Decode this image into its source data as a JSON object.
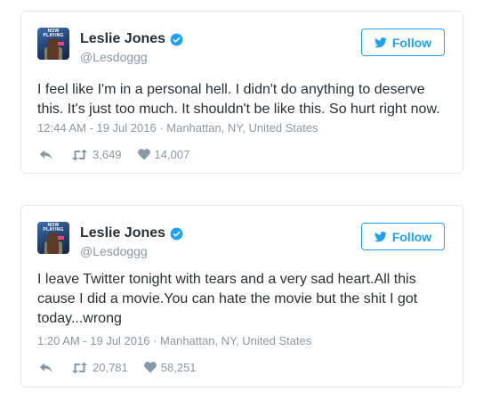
{
  "colors": {
    "brand": "#1da1f2",
    "text": "#292f33",
    "muted": "#8899a6",
    "border": "#e1e8ed"
  },
  "tweets": [
    {
      "name": "Leslie Jones",
      "handle": "@Lesdoggg",
      "avatar_tag": "NOW PLAYING",
      "follow_label": "Follow",
      "text": "I feel like I'm in a personal hell. I didn't do anything to deserve\nthis. It's just too much. It shouldn't be like this. So hurt right now.",
      "meta": "12:44 AM - 19 Jul 2016 · Manhattan, NY, United States",
      "retweets": "3,649",
      "likes": "14,007",
      "icons": [
        "verified-icon",
        "twitter-bird-icon",
        "reply-icon",
        "retweet-icon",
        "heart-icon"
      ]
    },
    {
      "name": "Leslie Jones",
      "handle": "@Lesdoggg",
      "avatar_tag": "NOW PLAYING",
      "follow_label": "Follow",
      "text": "I leave Twitter tonight with tears and a very sad heart.All this\ncause I did a movie.You can hate the movie but the shit I got\ntoday...wrong",
      "meta": "1:20 AM - 19 Jul 2016 · Manhattan, NY, United States",
      "retweets": "20,781",
      "likes": "58,251",
      "icons": [
        "verified-icon",
        "twitter-bird-icon",
        "reply-icon",
        "retweet-icon",
        "heart-icon"
      ]
    }
  ]
}
